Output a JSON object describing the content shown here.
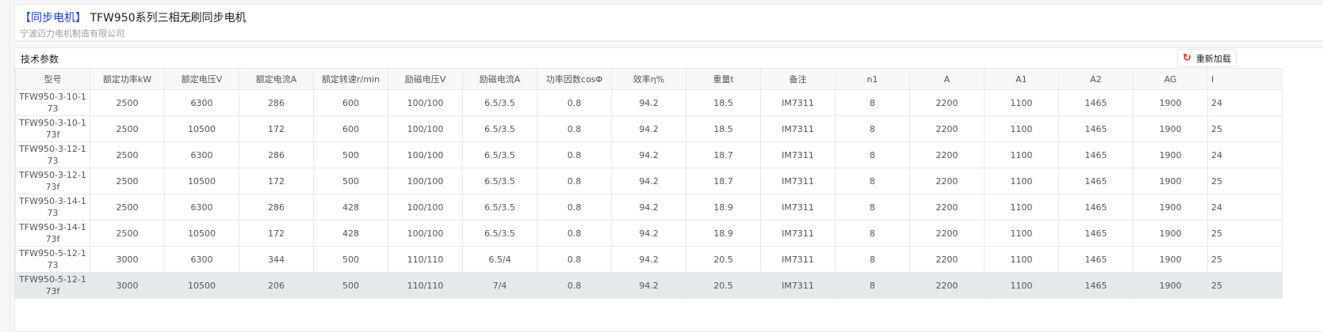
{
  "header": {
    "category_tag": "【同步电机】",
    "title": "TFW950系列三相无刷同步电机",
    "company": "宁波迈力电机制造有限公司"
  },
  "section": {
    "title": "技术参数",
    "reload_label": "重新加载",
    "reload_icon": "refresh-icon",
    "reload_icon_color": "#e0301e"
  },
  "table": {
    "columns": [
      "型号",
      "额定功率kW",
      "额定电压V",
      "额定电流A",
      "额定转速r/min",
      "励磁电压V",
      "励磁电流A",
      "功率因数cosΦ",
      "效率η%",
      "重量t",
      "备注",
      "n1",
      "A",
      "A1",
      "A2",
      "AG",
      "I"
    ],
    "rows": [
      [
        "TFW950-3-10-173",
        "2500",
        "6300",
        "286",
        "600",
        "100/100",
        "6.5/3.5",
        "0.8",
        "94.2",
        "18.5",
        "IM7311",
        "8",
        "2200",
        "1100",
        "1465",
        "1900",
        "24"
      ],
      [
        "TFW950-3-10-173f",
        "2500",
        "10500",
        "172",
        "600",
        "100/100",
        "6.5/3.5",
        "0.8",
        "94.2",
        "18.5",
        "IM7311",
        "8",
        "2200",
        "1100",
        "1465",
        "1900",
        "25"
      ],
      [
        "TFW950-3-12-173",
        "2500",
        "6300",
        "286",
        "500",
        "100/100",
        "6.5/3.5",
        "0.8",
        "94.2",
        "18.7",
        "IM7311",
        "8",
        "2200",
        "1100",
        "1465",
        "1900",
        "24"
      ],
      [
        "TFW950-3-12-173f",
        "2500",
        "10500",
        "172",
        "500",
        "100/100",
        "6.5/3.5",
        "0.8",
        "94.2",
        "18.7",
        "IM7311",
        "8",
        "2200",
        "1100",
        "1465",
        "1900",
        "25"
      ],
      [
        "TFW950-3-14-173",
        "2500",
        "6300",
        "286",
        "428",
        "100/100",
        "6.5/3.5",
        "0.8",
        "94.2",
        "18.9",
        "IM7311",
        "8",
        "2200",
        "1100",
        "1465",
        "1900",
        "24"
      ],
      [
        "TFW950-3-14-173f",
        "2500",
        "10500",
        "172",
        "428",
        "100/100",
        "6.5/3.5",
        "0.8",
        "94.2",
        "18.9",
        "IM7311",
        "8",
        "2200",
        "1100",
        "1465",
        "1900",
        "25"
      ],
      [
        "TFW950-5-12-173",
        "3000",
        "6300",
        "344",
        "500",
        "110/110",
        "6.5/4",
        "0.8",
        "94.2",
        "20.5",
        "IM7311",
        "8",
        "2200",
        "1100",
        "1465",
        "1900",
        "25"
      ],
      [
        "TFW950-5-12-173f",
        "3000",
        "10500",
        "206",
        "500",
        "110/110",
        "7/4",
        "0.8",
        "94.2",
        "20.5",
        "IM7311",
        "8",
        "2200",
        "1100",
        "1465",
        "1900",
        "25"
      ]
    ],
    "selected_row": 7
  }
}
